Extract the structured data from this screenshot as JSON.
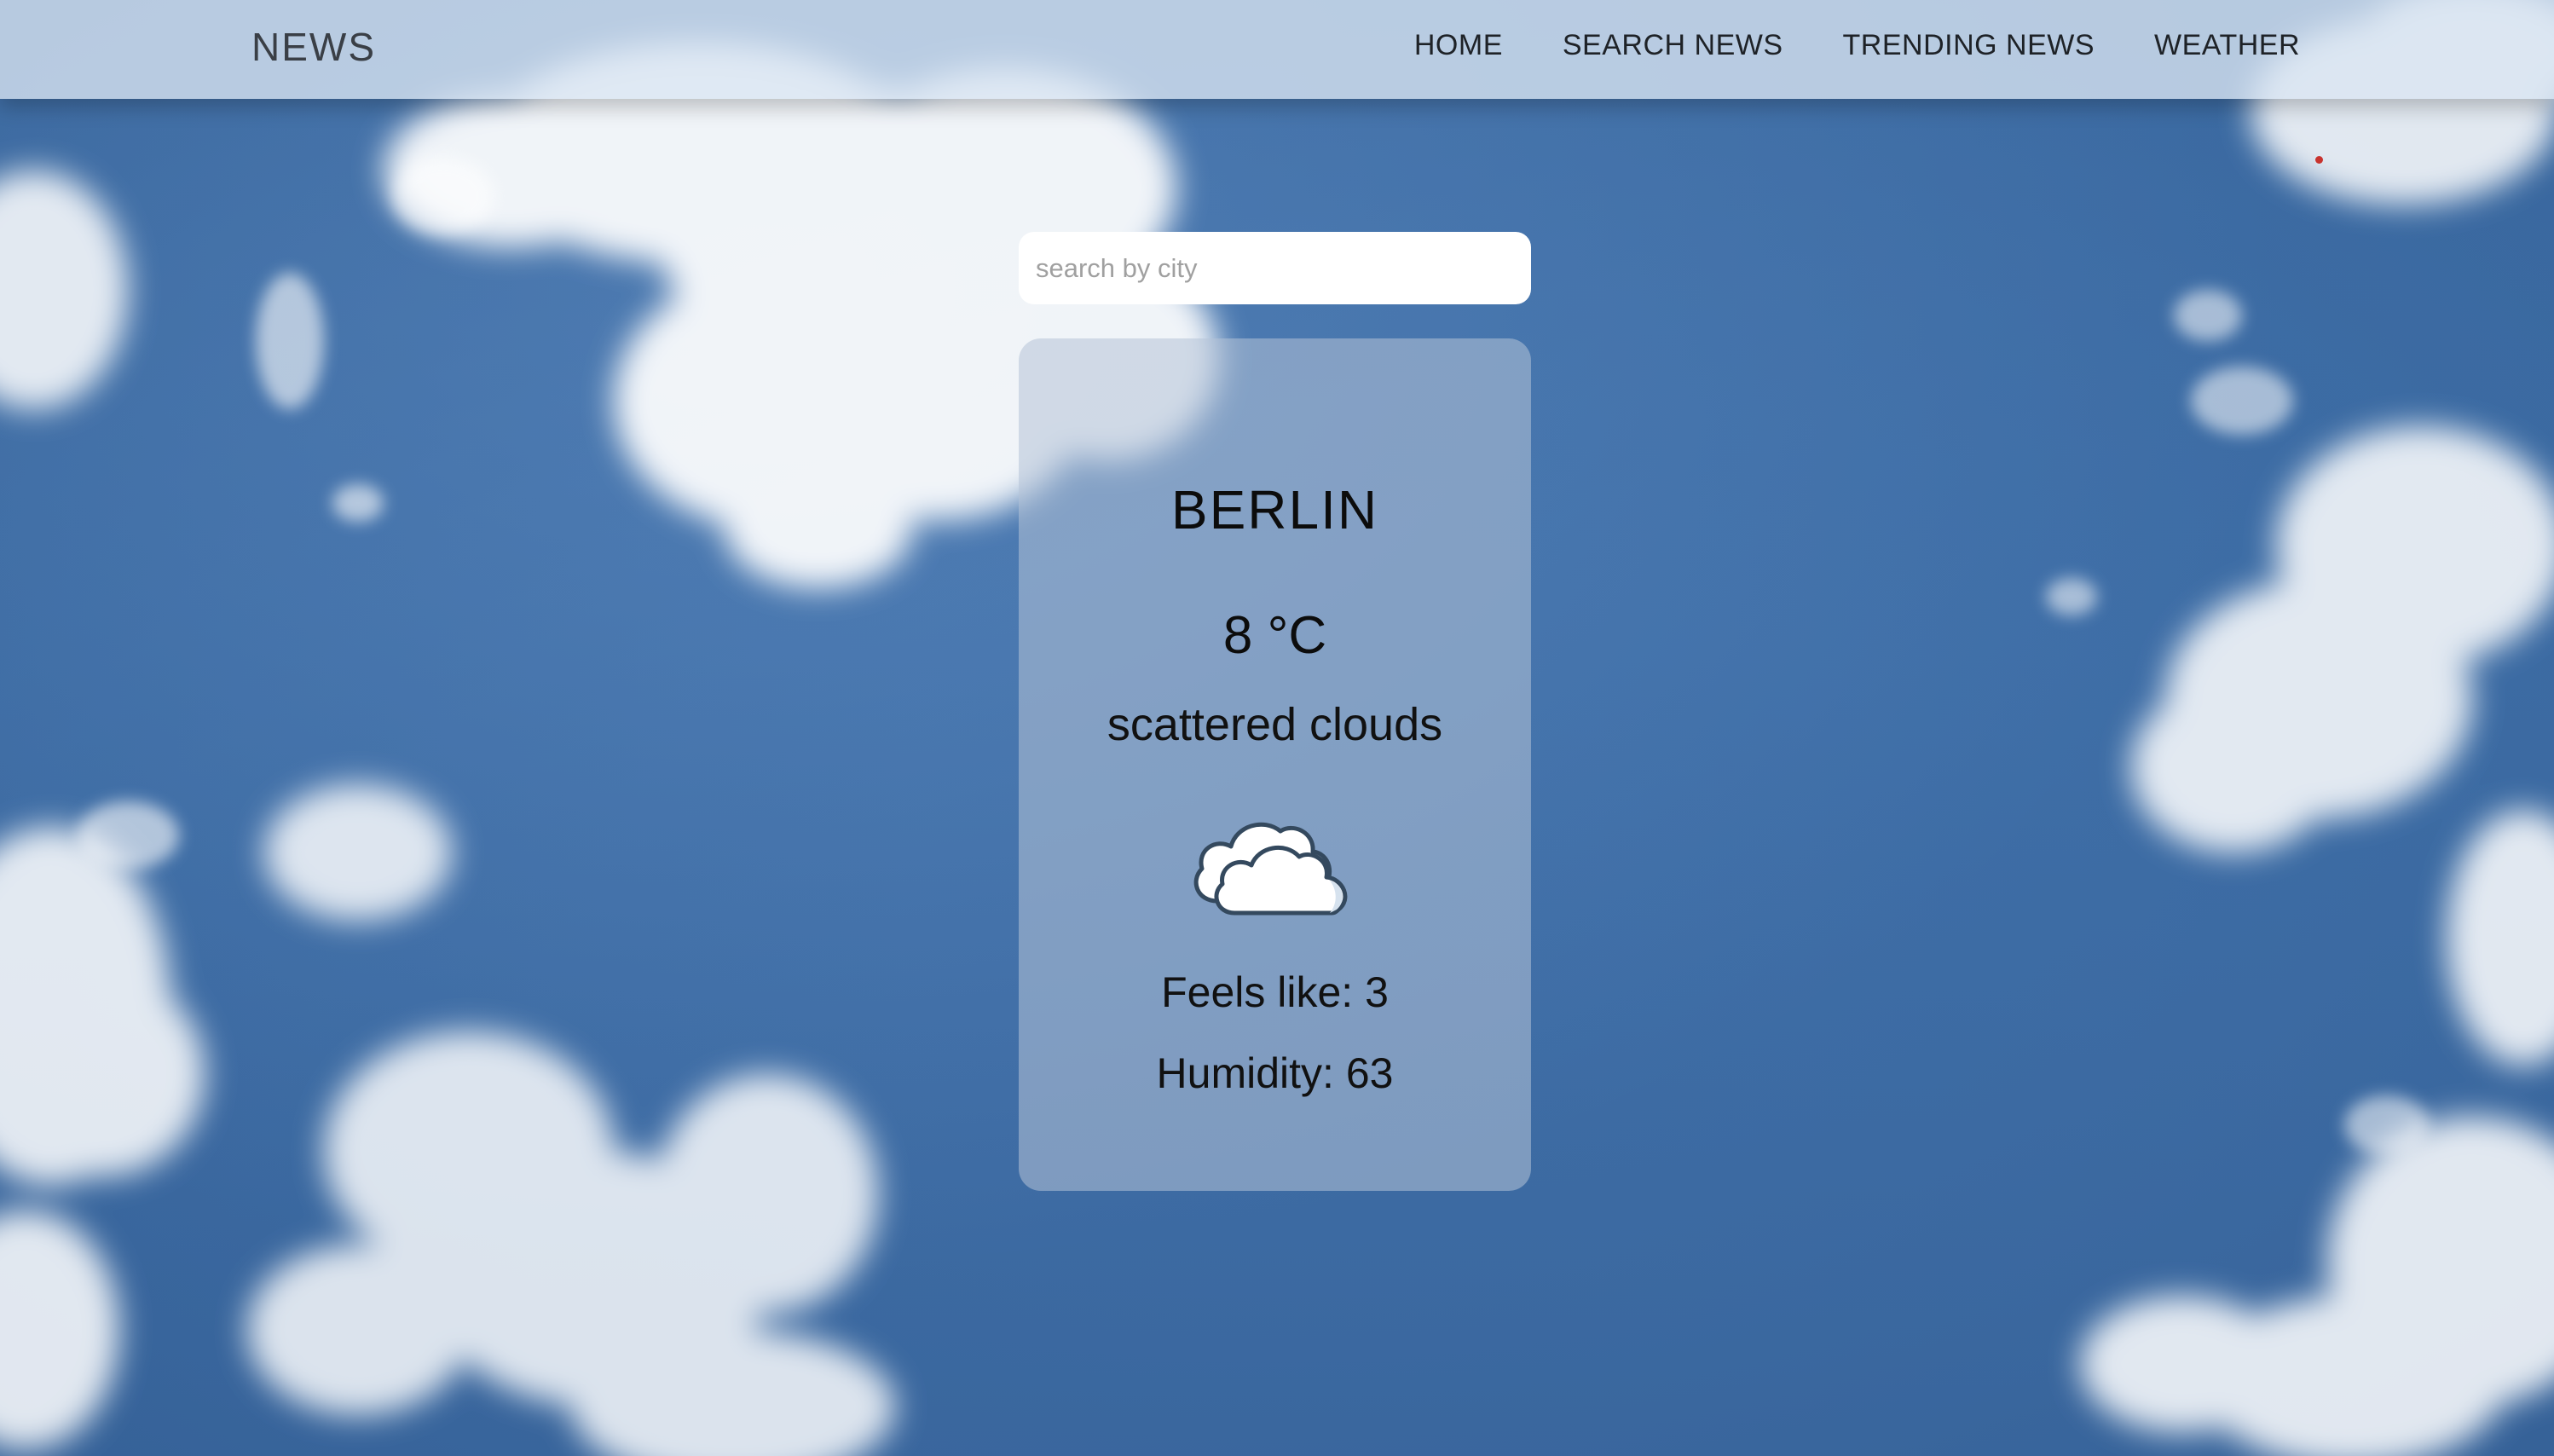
{
  "navbar": {
    "brand": "NEWS",
    "links": [
      {
        "label": "HOME"
      },
      {
        "label": "SEARCH NEWS"
      },
      {
        "label": "TRENDING NEWS"
      },
      {
        "label": "WEATHER"
      }
    ]
  },
  "search": {
    "placeholder": "search by city",
    "value": ""
  },
  "weather": {
    "city": "BERLIN",
    "temperature": "8 °C",
    "description": "scattered clouds",
    "icon": "scattered-clouds-icon",
    "feels_like": "Feels like: 3",
    "humidity": "Humidity: 63"
  },
  "colors": {
    "sky": "#3e6ea7",
    "navbar": "#dae6f2",
    "card": "#b4c3d7",
    "cloud_outline": "#3a4a5c"
  }
}
